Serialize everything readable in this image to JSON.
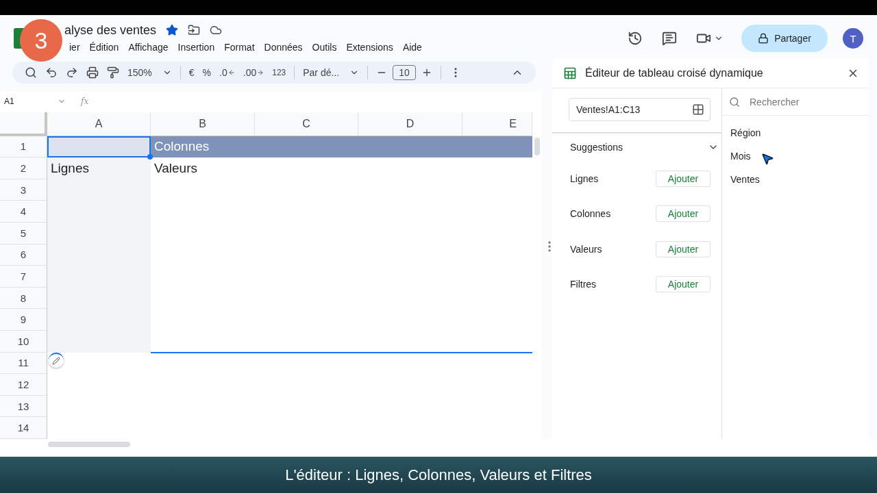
{
  "header": {
    "title": "alyse des ventes",
    "starred": true,
    "menu": [
      "ier",
      "Édition",
      "Affichage",
      "Insertion",
      "Format",
      "Données",
      "Outils",
      "Extensions",
      "Aide"
    ],
    "share": "Partager",
    "avatar": "T"
  },
  "step_badge": "3",
  "toolbar": {
    "zoom": "150%",
    "currency": "€",
    "percent": "%",
    "decimal_less": ".0",
    "decimal_more": ".00",
    "number_format": "123",
    "font": "Par dé...",
    "font_size": "10"
  },
  "formula_bar": {
    "cell": "A1",
    "fx": "fx"
  },
  "grid": {
    "columns": [
      "A",
      "B",
      "C",
      "D",
      "E"
    ],
    "row_labels": [
      "1",
      "2",
      "3",
      "4",
      "5",
      "6",
      "7",
      "8",
      "9",
      "10",
      "11",
      "12",
      "13",
      "14"
    ],
    "cell_a1": {
      "selected": true
    },
    "columns_label": "Colonnes",
    "rows_label": "Lignes",
    "values_label": "Valeurs"
  },
  "panel": {
    "title": "Éditeur de tableau croisé dynamique",
    "range": "Ventes!A1:C13",
    "suggestions": "Suggestions",
    "sections": [
      {
        "label": "Lignes",
        "button": "Ajouter"
      },
      {
        "label": "Colonnes",
        "button": "Ajouter"
      },
      {
        "label": "Valeurs",
        "button": "Ajouter"
      },
      {
        "label": "Filtres",
        "button": "Ajouter"
      }
    ],
    "search": {
      "placeholder": "Rechercher"
    },
    "fields": [
      "Région",
      "Mois",
      "Ventes"
    ]
  },
  "caption": "L'éditeur : Lignes, Colonnes, Valeurs et Filtres"
}
